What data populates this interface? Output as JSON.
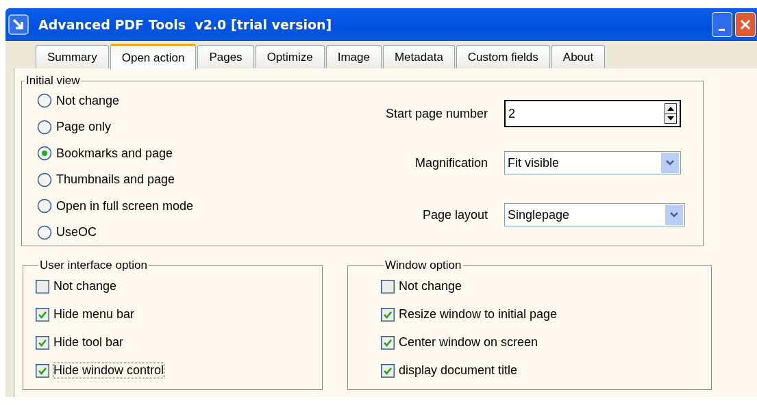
{
  "window": {
    "title": "Advanced PDF Tools  v2.0 [trial version]"
  },
  "tabs": [
    {
      "label": "Summary",
      "selected": false
    },
    {
      "label": "Open action",
      "selected": true
    },
    {
      "label": "Pages",
      "selected": false
    },
    {
      "label": "Optimize",
      "selected": false
    },
    {
      "label": "Image",
      "selected": false
    },
    {
      "label": "Metadata",
      "selected": false
    },
    {
      "label": "Custom fields",
      "selected": false
    },
    {
      "label": "About",
      "selected": false
    }
  ],
  "initial_view": {
    "title": "Initial view",
    "options": [
      {
        "label": "Not change",
        "selected": false
      },
      {
        "label": "Page only",
        "selected": false
      },
      {
        "label": "Bookmarks and page",
        "selected": true
      },
      {
        "label": "Thumbnails and page",
        "selected": false
      },
      {
        "label": "Open in full screen mode",
        "selected": false
      },
      {
        "label": "UseOC",
        "selected": false
      }
    ],
    "fields": [
      {
        "kind": "spin",
        "label": "Start page number",
        "value": "2"
      },
      {
        "kind": "dropdown",
        "label": "Magnification",
        "value": "Fit visible"
      },
      {
        "kind": "dropdown",
        "label": "Page layout",
        "value": "Singlepage"
      }
    ]
  },
  "user_interface_option": {
    "title": "User interface option",
    "options": [
      {
        "label": "Not change",
        "checked": false,
        "focused": false
      },
      {
        "label": "Hide menu bar",
        "checked": true,
        "focused": false
      },
      {
        "label": "Hide tool bar",
        "checked": true,
        "focused": false
      },
      {
        "label": "Hide window control",
        "checked": true,
        "focused": true
      }
    ]
  },
  "window_option": {
    "title": "Window option",
    "options": [
      {
        "label": "Not change",
        "checked": false,
        "focused": false
      },
      {
        "label": "Resize window to initial page",
        "checked": true,
        "focused": false
      },
      {
        "label": "Center window on screen",
        "checked": true,
        "focused": false
      },
      {
        "label": "display document title",
        "checked": true,
        "focused": false
      }
    ]
  }
}
